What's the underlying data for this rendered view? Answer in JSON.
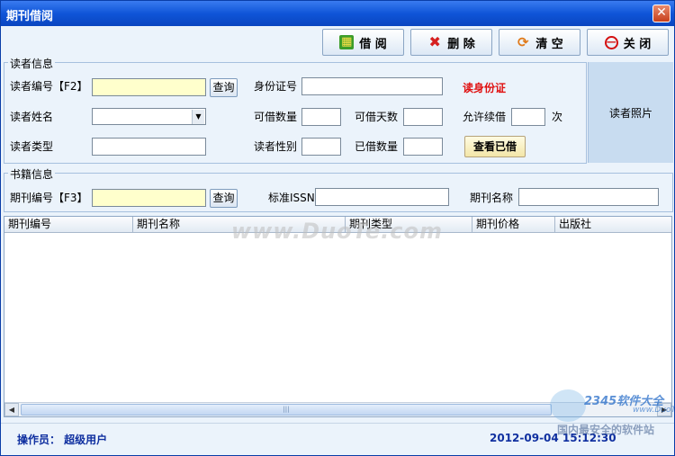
{
  "window": {
    "title": "期刊借阅",
    "close_glyph": "✕"
  },
  "toolbar": {
    "borrow_label": "借 阅",
    "delete_label": "删 除",
    "clear_label": "清 空",
    "close_label": "关 闭"
  },
  "reader_group": {
    "title": "读者信息",
    "reader_id_label": "读者编号【F2】",
    "reader_id_value": "",
    "query_label": "查询",
    "id_card_label": "身份证号",
    "id_card_value": "",
    "id_card_link": "读身份证",
    "name_label": "读者姓名",
    "name_value": "",
    "borrowable_count_label": "可借数量",
    "borrowable_count_value": "",
    "borrowable_days_label": "可借天数",
    "borrowable_days_value": "",
    "renew_label": "允许续借",
    "renew_value": "",
    "renew_unit": "次",
    "type_label": "读者类型",
    "type_value": "",
    "gender_label": "读者性别",
    "gender_value": "",
    "borrowed_count_label": "已借数量",
    "borrowed_count_value": "",
    "view_borrowed_label": "查看已借",
    "photo_label": "读者照片"
  },
  "book_group": {
    "title": "书籍信息",
    "periodical_id_label": "期刊编号【F3】",
    "periodical_id_value": "",
    "query_label": "查询",
    "issn_label": "标准ISSN",
    "issn_value": "",
    "periodical_name_label": "期刊名称",
    "periodical_name_value": ""
  },
  "grid": {
    "columns": [
      "期刊编号",
      "期刊名称",
      "期刊类型",
      "期刊价格",
      "出版社"
    ],
    "rows": []
  },
  "status": {
    "operator": "操作员： 超级用户",
    "datetime": "2012-09-04 15:12:30"
  },
  "watermarks": {
    "center": "www.DuoTe.com",
    "brand": "2345软件大全",
    "url": "www.DuoTe.com",
    "slogan": "国内最安全的软件站"
  }
}
